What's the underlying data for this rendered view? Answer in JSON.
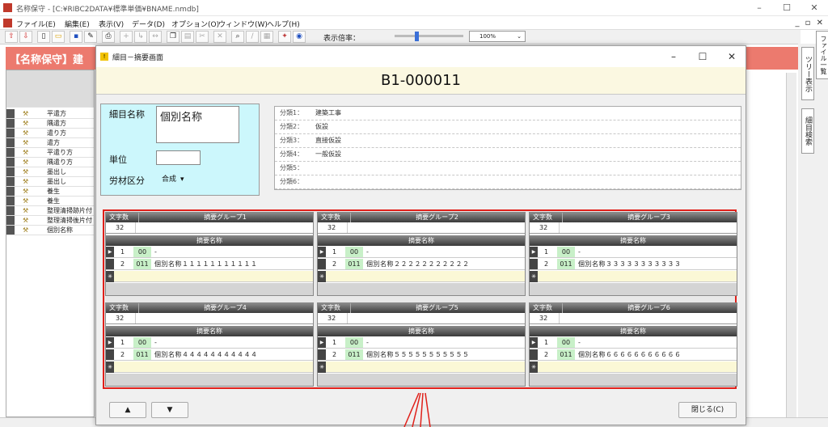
{
  "window": {
    "title": "名称保守 - [C:¥RIBC2DATA¥標準単価¥BNAME.nmdb]",
    "minimize": "–",
    "maximize": "☐",
    "close": "✕"
  },
  "menu": [
    "ファイル(E)",
    "編集(E)",
    "表示(V)",
    "データ(D)",
    "オプション(O)",
    "ウィンドウ(W)",
    "ヘルプ(H)"
  ],
  "toolbar": {
    "zoom_label": "表示倍率：",
    "zoom_value": "100%",
    "zoom_level": 0.33
  },
  "background": {
    "header": "【名称保守】建",
    "rows": [
      "平遣方",
      "隅遣方",
      "遣り方",
      "遣方",
      "平遣り方",
      "隅遣り方",
      "墨出し",
      "墨出し",
      "養生",
      "養生",
      "整理清掃跡片付",
      "整理清掃後片付",
      "個別名称"
    ],
    "tabs": [
      "ツリー表示",
      "細目検索"
    ],
    "mdi_controls": "_ ▫ ✕"
  },
  "dialog": {
    "title": "細目－摘要画面",
    "code": "B1-000011",
    "name_label": "細目名称",
    "name_value": "個別名称",
    "unit_label": "単位",
    "unit_value": "",
    "material_label": "労材区分",
    "material_value": "合成",
    "classes": [
      {
        "label": "分類1：",
        "value": "建築工事"
      },
      {
        "label": "分類2：",
        "value": "仮設"
      },
      {
        "label": "分類3：",
        "value": "直接仮設"
      },
      {
        "label": "分類4：",
        "value": "一般仮設"
      },
      {
        "label": "分類5：",
        "value": ""
      },
      {
        "label": "分類6：",
        "value": ""
      }
    ],
    "count_header": "文字数",
    "sub_header": "摘要名称",
    "groups": [
      {
        "title": "摘要グループ1",
        "count": "32",
        "rows": [
          {
            "n": "1",
            "code": "00",
            "name": "-"
          },
          {
            "n": "2",
            "code": "011",
            "name": "個別名称１１１１１１１１１１１"
          }
        ]
      },
      {
        "title": "摘要グループ2",
        "count": "32",
        "rows": [
          {
            "n": "1",
            "code": "00",
            "name": "-"
          },
          {
            "n": "2",
            "code": "011",
            "name": "個別名称２２２２２２２２２２２"
          }
        ]
      },
      {
        "title": "摘要グループ3",
        "count": "32",
        "rows": [
          {
            "n": "1",
            "code": "00",
            "name": "-"
          },
          {
            "n": "2",
            "code": "011",
            "name": "個別名称３３３３３３３３３３３"
          }
        ]
      },
      {
        "title": "摘要グループ4",
        "count": "32",
        "rows": [
          {
            "n": "1",
            "code": "00",
            "name": "-"
          },
          {
            "n": "2",
            "code": "011",
            "name": "個別名称４４４４４４４４４４４"
          }
        ]
      },
      {
        "title": "摘要グループ5",
        "count": "32",
        "rows": [
          {
            "n": "1",
            "code": "00",
            "name": "-"
          },
          {
            "n": "2",
            "code": "011",
            "name": "個別名称５５５５５５５５５５５"
          }
        ]
      },
      {
        "title": "摘要グループ6",
        "count": "32",
        "rows": [
          {
            "n": "1",
            "code": "00",
            "name": "-"
          },
          {
            "n": "2",
            "code": "011",
            "name": "個別名称６６６６６６６６６６６"
          }
        ]
      }
    ],
    "btn_up": "▲",
    "btn_down": "▼",
    "btn_close": "閉じる(C)"
  }
}
